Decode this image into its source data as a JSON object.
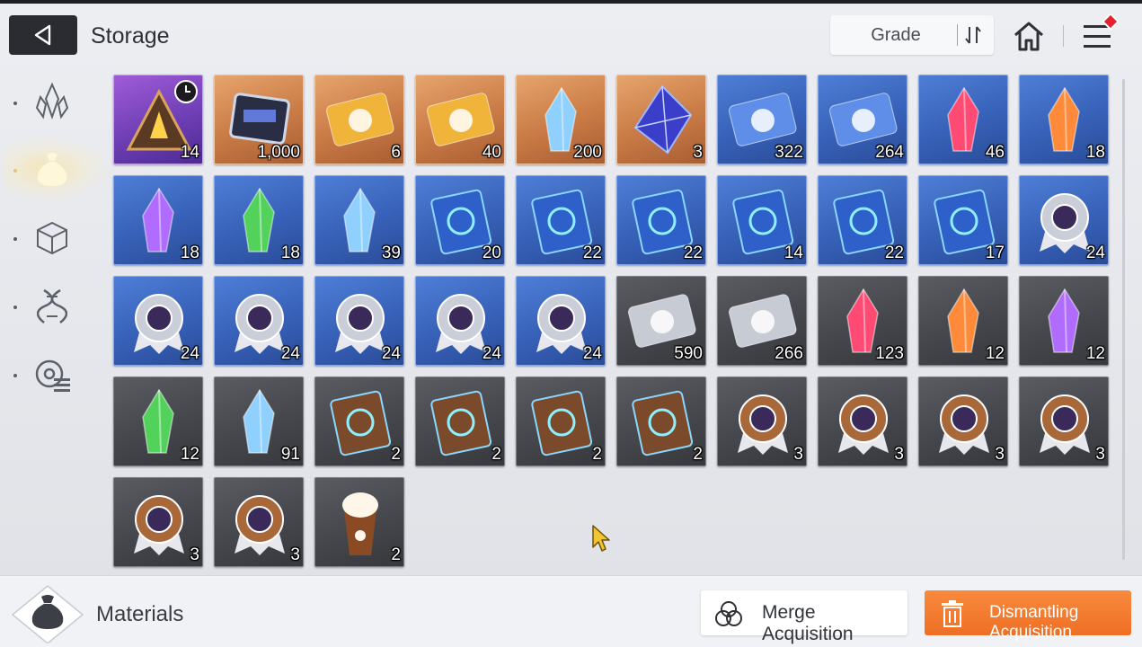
{
  "header": {
    "title": "Storage",
    "sort_label": "Grade"
  },
  "sidebar": {
    "items": [
      {
        "icon": "crystal-cluster-icon",
        "active": false
      },
      {
        "icon": "pouch-icon",
        "active": true
      },
      {
        "icon": "cube-icon",
        "active": false
      },
      {
        "icon": "dna-icon",
        "active": false
      },
      {
        "icon": "gear-list-icon",
        "active": false
      }
    ]
  },
  "items": [
    {
      "name": "timed-pyramid-chip",
      "rarity": "purple",
      "qty": "14",
      "timed": true
    },
    {
      "name": "data-chip",
      "rarity": "orange",
      "qty": "1,000"
    },
    {
      "name": "gold-character-ticket",
      "rarity": "orange",
      "qty": "6"
    },
    {
      "name": "gold-weapon-ticket",
      "rarity": "orange",
      "qty": "40"
    },
    {
      "name": "gold-shard-cluster",
      "rarity": "orange",
      "qty": "200"
    },
    {
      "name": "blue-prism-core",
      "rarity": "orange",
      "qty": "3"
    },
    {
      "name": "blue-character-ticket",
      "rarity": "blue",
      "qty": "322"
    },
    {
      "name": "blue-weapon-ticket",
      "rarity": "blue",
      "qty": "264"
    },
    {
      "name": "red-crystal",
      "rarity": "blue",
      "qty": "46"
    },
    {
      "name": "fire-crystal",
      "rarity": "blue",
      "qty": "18"
    },
    {
      "name": "purple-crystal",
      "rarity": "blue",
      "qty": "18"
    },
    {
      "name": "green-crystal",
      "rarity": "blue",
      "qty": "18"
    },
    {
      "name": "ice-crystal",
      "rarity": "blue",
      "qty": "39"
    },
    {
      "name": "skill-book-swords",
      "rarity": "blue",
      "qty": "20"
    },
    {
      "name": "skill-book-shield",
      "rarity": "blue",
      "qty": "22"
    },
    {
      "name": "skill-book-target",
      "rarity": "blue",
      "qty": "22"
    },
    {
      "name": "skill-book-wings",
      "rarity": "blue",
      "qty": "14"
    },
    {
      "name": "skill-book-bolt",
      "rarity": "blue",
      "qty": "22"
    },
    {
      "name": "skill-book-orb",
      "rarity": "blue",
      "qty": "17"
    },
    {
      "name": "medal-sword",
      "rarity": "blue",
      "qty": "24"
    },
    {
      "name": "medal-shield",
      "rarity": "blue",
      "qty": "24"
    },
    {
      "name": "medal-target",
      "rarity": "blue",
      "qty": "24"
    },
    {
      "name": "medal-cross",
      "rarity": "blue",
      "qty": "24"
    },
    {
      "name": "medal-bolt",
      "rarity": "blue",
      "qty": "24"
    },
    {
      "name": "medal-orb",
      "rarity": "blue",
      "qty": "24"
    },
    {
      "name": "silver-character-ticket",
      "rarity": "gray",
      "qty": "590"
    },
    {
      "name": "silver-weapon-ticket",
      "rarity": "gray",
      "qty": "266"
    },
    {
      "name": "red-shard",
      "rarity": "gray",
      "qty": "123"
    },
    {
      "name": "orange-shard",
      "rarity": "gray",
      "qty": "12"
    },
    {
      "name": "purple-shard",
      "rarity": "gray",
      "qty": "12"
    },
    {
      "name": "green-shard",
      "rarity": "gray",
      "qty": "12"
    },
    {
      "name": "ice-shard",
      "rarity": "gray",
      "qty": "91"
    },
    {
      "name": "bronze-book-shield",
      "rarity": "gray",
      "qty": "2"
    },
    {
      "name": "bronze-book-target",
      "rarity": "gray",
      "qty": "2"
    },
    {
      "name": "bronze-book-wings",
      "rarity": "gray",
      "qty": "2"
    },
    {
      "name": "bronze-book-bolt",
      "rarity": "gray",
      "qty": "2"
    },
    {
      "name": "bronze-medal-sword",
      "rarity": "gray",
      "qty": "3"
    },
    {
      "name": "bronze-medal-shield",
      "rarity": "gray",
      "qty": "3"
    },
    {
      "name": "bronze-medal-target",
      "rarity": "gray",
      "qty": "3"
    },
    {
      "name": "bronze-medal-cross",
      "rarity": "gray",
      "qty": "3"
    },
    {
      "name": "bronze-medal-bolt",
      "rarity": "gray",
      "qty": "3"
    },
    {
      "name": "bronze-medal-orb",
      "rarity": "gray",
      "qty": "3"
    },
    {
      "name": "iced-coffee-drink",
      "rarity": "gray",
      "qty": "2"
    }
  ],
  "footer": {
    "category_label": "Materials",
    "merge_label": "Merge Acquisition",
    "dismantle_label": "Dismantling Acquisition"
  },
  "colors": {
    "accent": "#ef7a2e",
    "badge": "#e5202e",
    "purple_slot": "#7a46bf",
    "orange_slot": "#cc7c47",
    "blue_slot": "#3a64ba",
    "gray_slot": "#47494e"
  }
}
